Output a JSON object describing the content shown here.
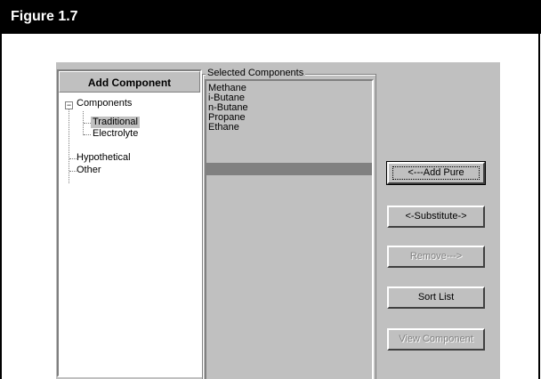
{
  "figure": {
    "title": "Figure 1.7"
  },
  "tree_panel": {
    "header": "Add Component",
    "nodes": [
      {
        "label": "Components",
        "expanded": true
      },
      {
        "label": "Traditional",
        "selected": true
      },
      {
        "label": "Electrolyte"
      },
      {
        "label": "Hypothetical"
      },
      {
        "label": "Other"
      }
    ],
    "expander_symbol": "−"
  },
  "selected_components": {
    "label": "Selected Components",
    "items": [
      "Methane",
      "i-Butane",
      "n-Butane",
      "Propane",
      "Ethane"
    ]
  },
  "buttons": {
    "add_pure": "<---Add Pure",
    "substitute": "<-Substitute->",
    "remove": "Remove--->",
    "sort_list": "Sort List",
    "view_component": "View Component"
  },
  "colors": {
    "header_bg": "#000000",
    "dialog_bg": "#c0c0c0",
    "list_highlight": "#808080"
  }
}
